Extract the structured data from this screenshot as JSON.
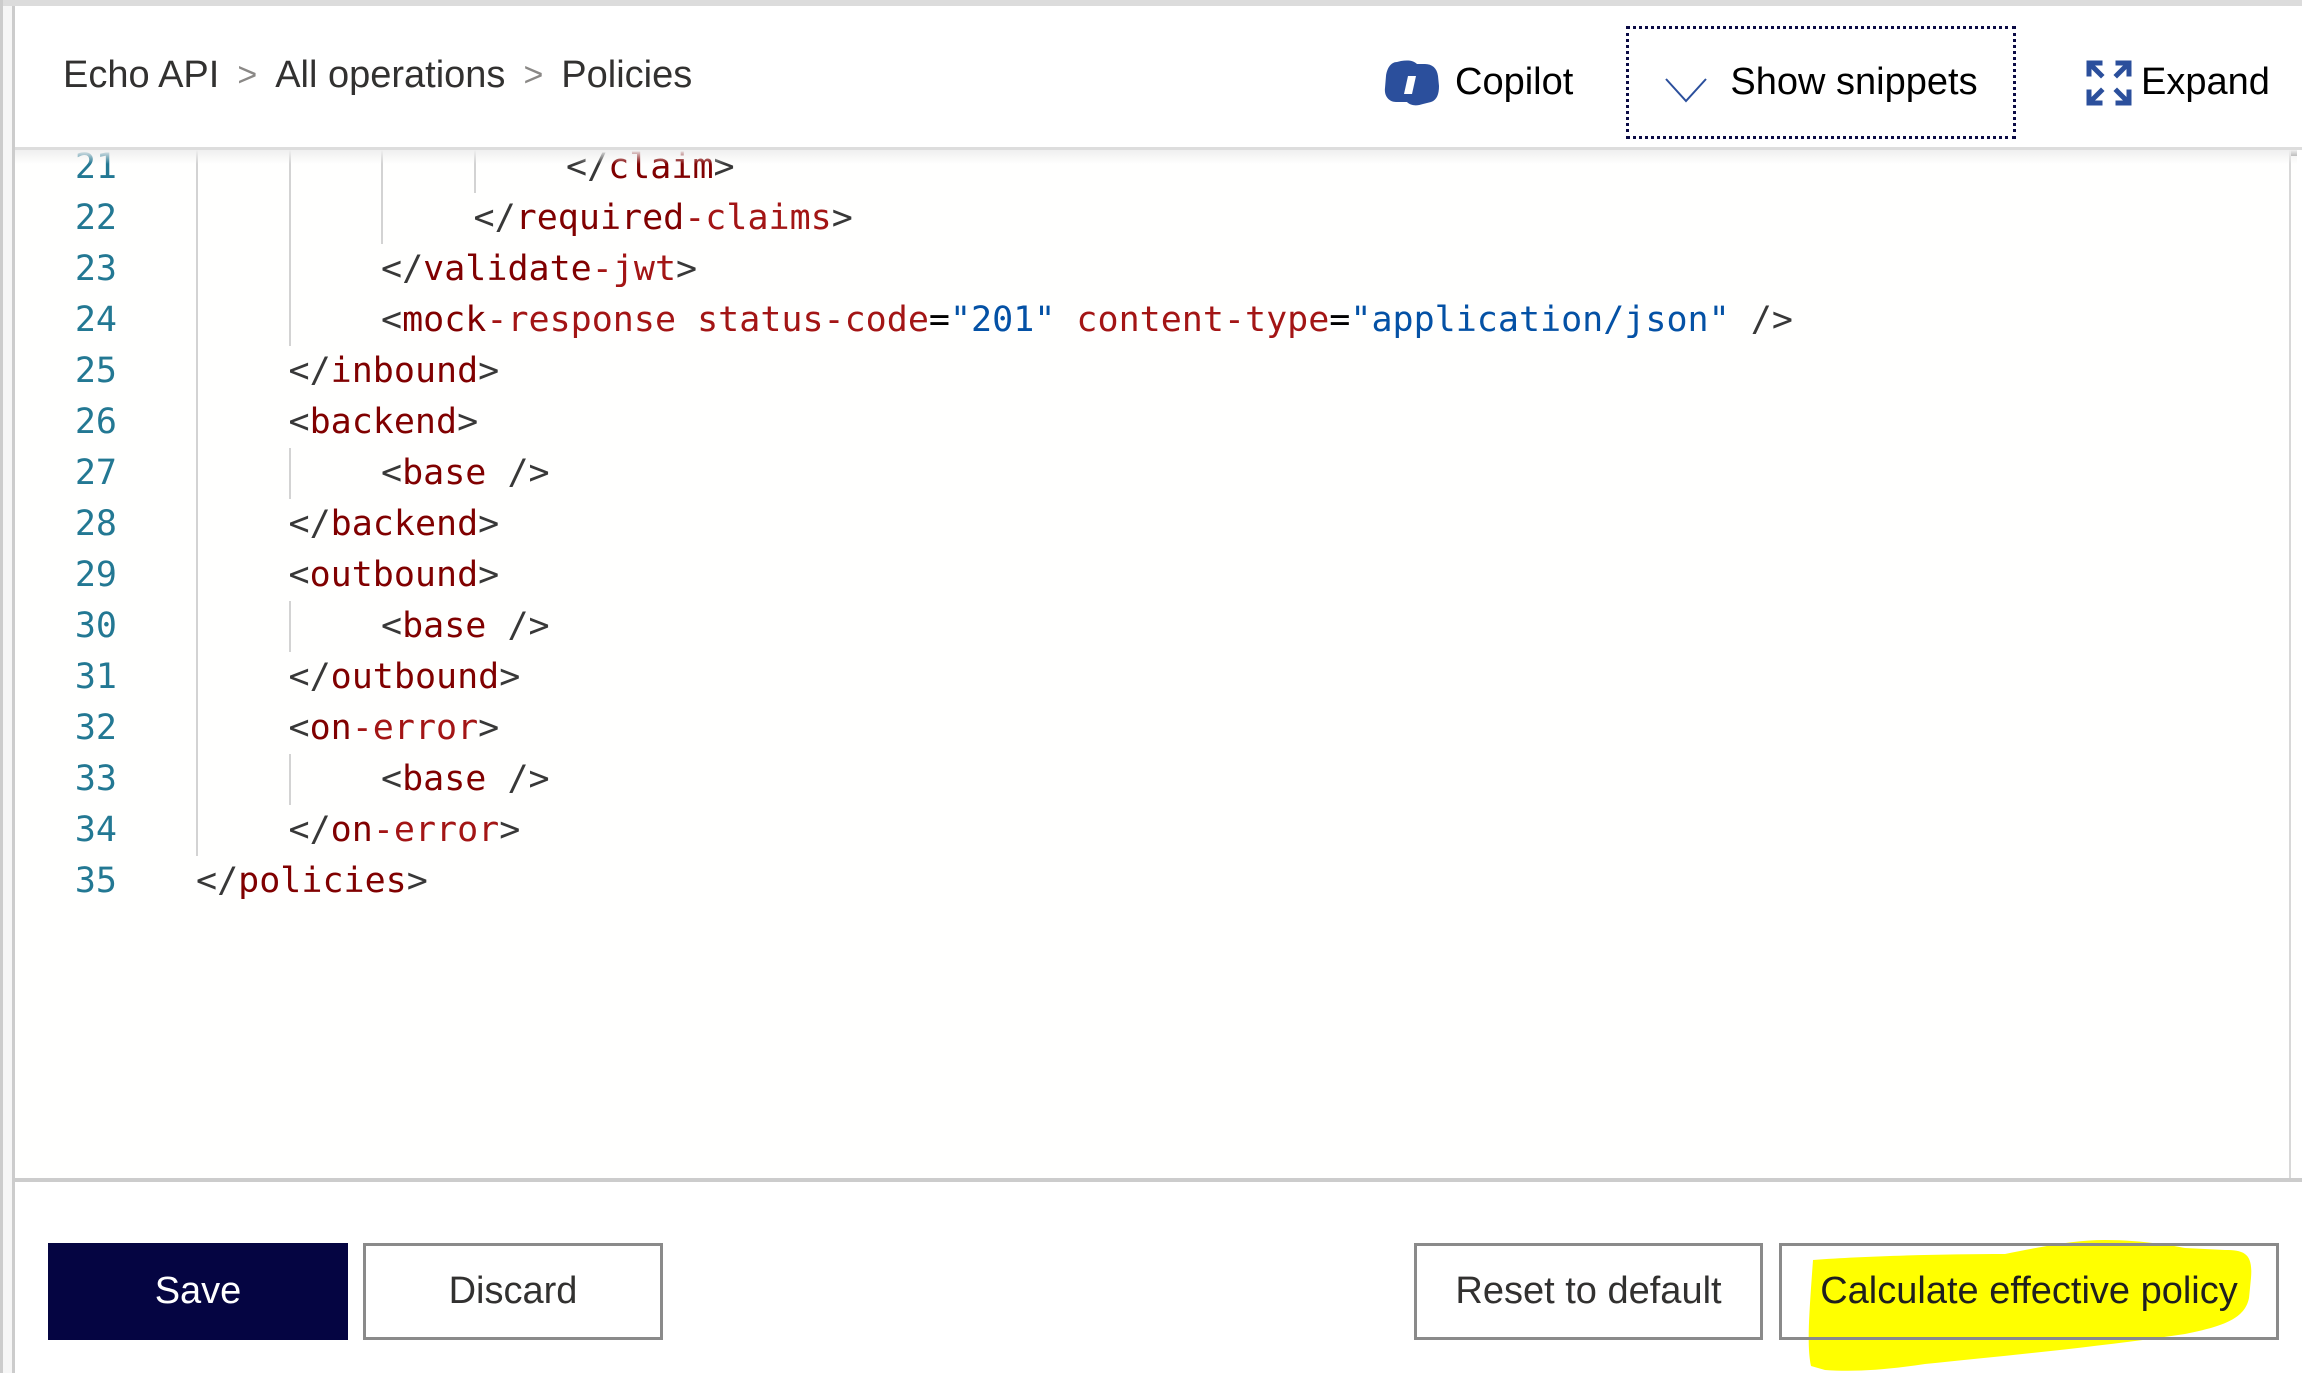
{
  "header": {
    "breadcrumb": [
      {
        "label": "Echo API"
      },
      {
        "label": "All operations"
      },
      {
        "label": "Policies"
      }
    ],
    "breadcrumb_separator": ">",
    "toolbar": {
      "copilot_label": "Copilot",
      "copilot_icon": "copilot-icon",
      "snippets_label": "Show snippets",
      "snippets_icon": "chevron-down-icon",
      "expand_label": "Expand",
      "expand_icon": "expand-arrows-icon"
    }
  },
  "editor": {
    "language": "xml",
    "lines": [
      {
        "number": "21",
        "indent": 4,
        "tokens": [
          {
            "t": "</",
            "c": "delim"
          },
          {
            "t": "claim",
            "c": "tag"
          },
          {
            "t": ">",
            "c": "delim"
          }
        ]
      },
      {
        "number": "22",
        "indent": 3,
        "tokens": [
          {
            "t": "</",
            "c": "delim"
          },
          {
            "t": "required",
            "c": "tag"
          },
          {
            "t": "-claims",
            "c": "tag2"
          },
          {
            "t": ">",
            "c": "delim"
          }
        ]
      },
      {
        "number": "23",
        "indent": 2,
        "tokens": [
          {
            "t": "</",
            "c": "delim"
          },
          {
            "t": "validate",
            "c": "tag"
          },
          {
            "t": "-jwt",
            "c": "tag2"
          },
          {
            "t": ">",
            "c": "delim"
          }
        ]
      },
      {
        "number": "24",
        "indent": 2,
        "tokens": [
          {
            "t": "<",
            "c": "delim"
          },
          {
            "t": "mock",
            "c": "tag"
          },
          {
            "t": "-response",
            "c": "tag2"
          },
          {
            "t": " ",
            "c": "eq"
          },
          {
            "t": "status-code",
            "c": "attr"
          },
          {
            "t": "=",
            "c": "eq"
          },
          {
            "t": "\"201\"",
            "c": "str"
          },
          {
            "t": " ",
            "c": "eq"
          },
          {
            "t": "content-type",
            "c": "attr"
          },
          {
            "t": "=",
            "c": "eq"
          },
          {
            "t": "\"application/json\"",
            "c": "str"
          },
          {
            "t": " />",
            "c": "delim"
          }
        ]
      },
      {
        "number": "25",
        "indent": 1,
        "tokens": [
          {
            "t": "</",
            "c": "delim"
          },
          {
            "t": "inbound",
            "c": "tag"
          },
          {
            "t": ">",
            "c": "delim"
          }
        ]
      },
      {
        "number": "26",
        "indent": 1,
        "tokens": [
          {
            "t": "<",
            "c": "delim"
          },
          {
            "t": "backend",
            "c": "tag"
          },
          {
            "t": ">",
            "c": "delim"
          }
        ]
      },
      {
        "number": "27",
        "indent": 2,
        "tokens": [
          {
            "t": "<",
            "c": "delim"
          },
          {
            "t": "base",
            "c": "tag"
          },
          {
            "t": " />",
            "c": "delim"
          }
        ]
      },
      {
        "number": "28",
        "indent": 1,
        "tokens": [
          {
            "t": "</",
            "c": "delim"
          },
          {
            "t": "backend",
            "c": "tag"
          },
          {
            "t": ">",
            "c": "delim"
          }
        ]
      },
      {
        "number": "29",
        "indent": 1,
        "tokens": [
          {
            "t": "<",
            "c": "delim"
          },
          {
            "t": "outbound",
            "c": "tag"
          },
          {
            "t": ">",
            "c": "delim"
          }
        ]
      },
      {
        "number": "30",
        "indent": 2,
        "tokens": [
          {
            "t": "<",
            "c": "delim"
          },
          {
            "t": "base",
            "c": "tag"
          },
          {
            "t": " />",
            "c": "delim"
          }
        ]
      },
      {
        "number": "31",
        "indent": 1,
        "tokens": [
          {
            "t": "</",
            "c": "delim"
          },
          {
            "t": "outbound",
            "c": "tag"
          },
          {
            "t": ">",
            "c": "delim"
          }
        ]
      },
      {
        "number": "32",
        "indent": 1,
        "tokens": [
          {
            "t": "<",
            "c": "delim"
          },
          {
            "t": "on",
            "c": "tag"
          },
          {
            "t": "-error",
            "c": "tag2"
          },
          {
            "t": ">",
            "c": "delim"
          }
        ]
      },
      {
        "number": "33",
        "indent": 2,
        "tokens": [
          {
            "t": "<",
            "c": "delim"
          },
          {
            "t": "base",
            "c": "tag"
          },
          {
            "t": " />",
            "c": "delim"
          }
        ]
      },
      {
        "number": "34",
        "indent": 1,
        "tokens": [
          {
            "t": "</",
            "c": "delim"
          },
          {
            "t": "on",
            "c": "tag"
          },
          {
            "t": "-error",
            "c": "tag2"
          },
          {
            "t": ">",
            "c": "delim"
          }
        ]
      },
      {
        "number": "35",
        "indent": 0,
        "tokens": [
          {
            "t": "</",
            "c": "delim"
          },
          {
            "t": "policies",
            "c": "tag"
          },
          {
            "t": ">",
            "c": "delim"
          }
        ]
      }
    ]
  },
  "footer": {
    "save_label": "Save",
    "discard_label": "Discard",
    "reset_label": "Reset to default",
    "calculate_label": "Calculate effective policy",
    "calculate_highlighted": true
  },
  "colors": {
    "primary_button": "#050542",
    "highlight": "#ffff00",
    "icon_blue": "#2b4f9c",
    "line_number": "#237893",
    "xml_tag": "#800000",
    "xml_attr": "#a31515",
    "xml_string": "#0451a5"
  }
}
